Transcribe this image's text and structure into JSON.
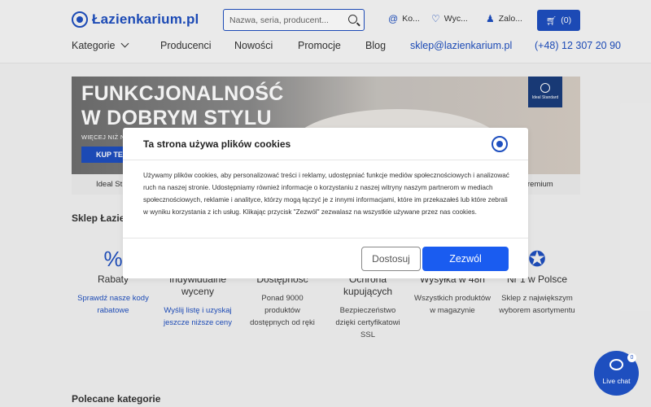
{
  "header": {
    "logo": "Łazienkarium.pl",
    "search_placeholder": "Nazwa, seria, producent...",
    "contact_label": "Ko...",
    "wishlist_label": "Wyc...",
    "login_label": "Zalo...",
    "cart_count": "(0)"
  },
  "nav": {
    "items": [
      "Kategorie",
      "Producenci",
      "Nowości",
      "Promocje",
      "Blog"
    ],
    "email": "sklep@lazienkarium.pl",
    "phone": "(+48) 12 307 20 90"
  },
  "banner": {
    "title_line1": "FUNKCJONALNOŚĆ",
    "title_line2": "W DOBRYM STYLU",
    "subtitle": "WIĘCEJ NIŻ N",
    "cta": "KUP TE",
    "brand": "Ideal Standard",
    "tabs": [
      "Ideal St",
      "remium"
    ]
  },
  "sections": {
    "shop_title": "Sklep Łazie",
    "featured_title": "Polecane kategorie"
  },
  "features": [
    {
      "icon": "percent-icon",
      "title": "Rabaty",
      "desc": "Sprawdź nasze kody rabatowe",
      "link": true
    },
    {
      "icon": "document-icon",
      "title": "Indywidualne wyceny",
      "desc": "Wyślij listę i uzyskaj jeszcze niższe ceny",
      "link": true
    },
    {
      "icon": "box-icon",
      "title": "Dostępność",
      "desc": "Ponad 9000 produktów dostępnych od ręki",
      "link": false
    },
    {
      "icon": "shield-icon",
      "title": "Ochrona kupujących",
      "desc": "Bezpieczeństwo dzięki certyfikatowi SSL",
      "link": false
    },
    {
      "icon": "truck-icon",
      "title": "Wysyłka w 48h",
      "desc": "Wszystkich produktów w magazynie",
      "link": false
    },
    {
      "icon": "award-icon",
      "title": "Nr 1 w Polsce",
      "desc": "Sklep z największym wyborem asortymentu",
      "link": false
    }
  ],
  "cookie_modal": {
    "title": "Ta strona używa plików cookies",
    "body": "Używamy plików cookies, aby personalizować treści i reklamy, udostępniać funkcje mediów społecznościowych i analizować ruch na naszej stronie. Udostępniamy również informacje o korzystaniu z naszej witryny naszym partnerom w mediach społecznościowych, reklamie i analityce, którzy mogą łączyć je z innymi informacjami, które im przekazałeś lub które zebrali w wyniku korzystania z ich usług. Klikając przycisk \"Zezwól\" zezwalasz na wszystkie używane przez nas cookies.",
    "adjust_button": "Dostosuj",
    "allow_button": "Zezwól"
  },
  "live_chat": {
    "label": "Live chat",
    "badge": "0"
  },
  "colors": {
    "brand_blue": "#1e4fbf",
    "allow_blue": "#1a5cf0"
  }
}
